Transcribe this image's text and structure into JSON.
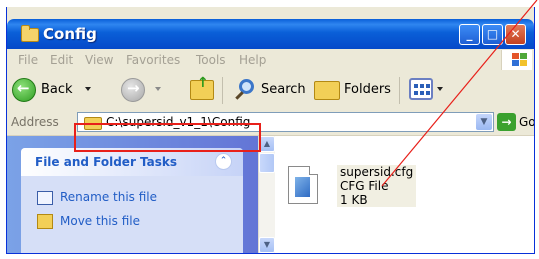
{
  "window": {
    "title": "Config"
  },
  "menu": [
    "File",
    "Edit",
    "View",
    "Favorites",
    "Tools",
    "Help"
  ],
  "toolbar": {
    "back": "Back",
    "search": "Search",
    "folders": "Folders"
  },
  "address": {
    "label": "Address",
    "path": "C:\\supersid_v1_1\\Config",
    "go": "Go"
  },
  "taskpane": {
    "title": "File and Folder Tasks",
    "tasks": [
      "Rename this file",
      "Move this file"
    ]
  },
  "file": {
    "name": "supersid.cfg",
    "type": "CFG File",
    "size": "1 KB"
  },
  "colors": {
    "highlight_box": "#e8201a",
    "pointer_line": "#e8201a",
    "title_bar": "#0a5fd8"
  }
}
